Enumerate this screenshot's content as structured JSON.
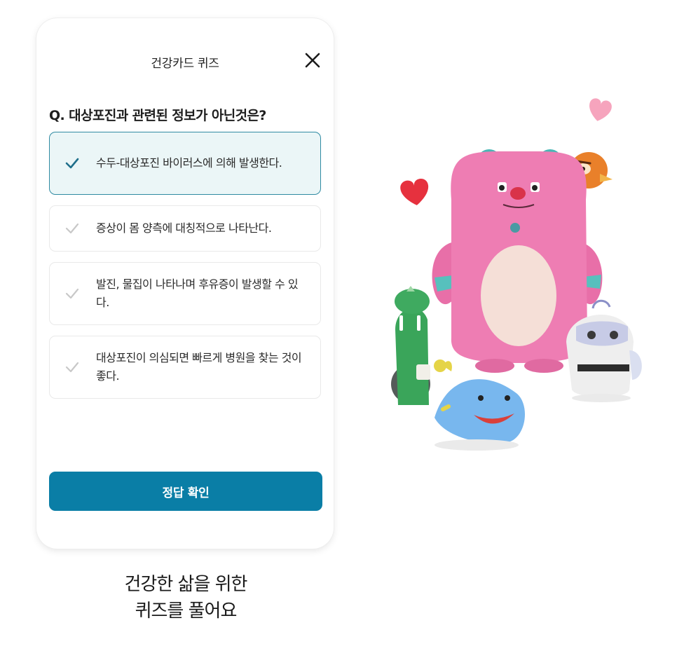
{
  "header": {
    "title": "건강카드 퀴즈",
    "close_icon": "close-icon"
  },
  "quiz": {
    "question": "Q. 대상포진과 관련된 정보가 아닌것은?",
    "options": [
      {
        "label": "수두-대상포진 바이러스에 의해 발생한다.",
        "selected": true
      },
      {
        "label": "증상이 몸 양측에 대칭적으로 나타난다.",
        "selected": false
      },
      {
        "label": "발진, 물집이 나타나며 후유증이 발생할 수 있다.",
        "selected": false
      },
      {
        "label": "대상포진이 의심되면 빠르게 병원을 찾는 것이 좋다.",
        "selected": false
      }
    ],
    "submit_label": "정답 확인"
  },
  "caption": {
    "line1": "건강한 삶을 위한",
    "line2": "퀴즈를 풀어요"
  },
  "colors": {
    "accent": "#0a7ea6",
    "selected_bg": "#ebf6f7",
    "selected_border": "#2f8aa2",
    "check_active": "#1f6f8b",
    "check_inactive": "#c8c8c8"
  }
}
